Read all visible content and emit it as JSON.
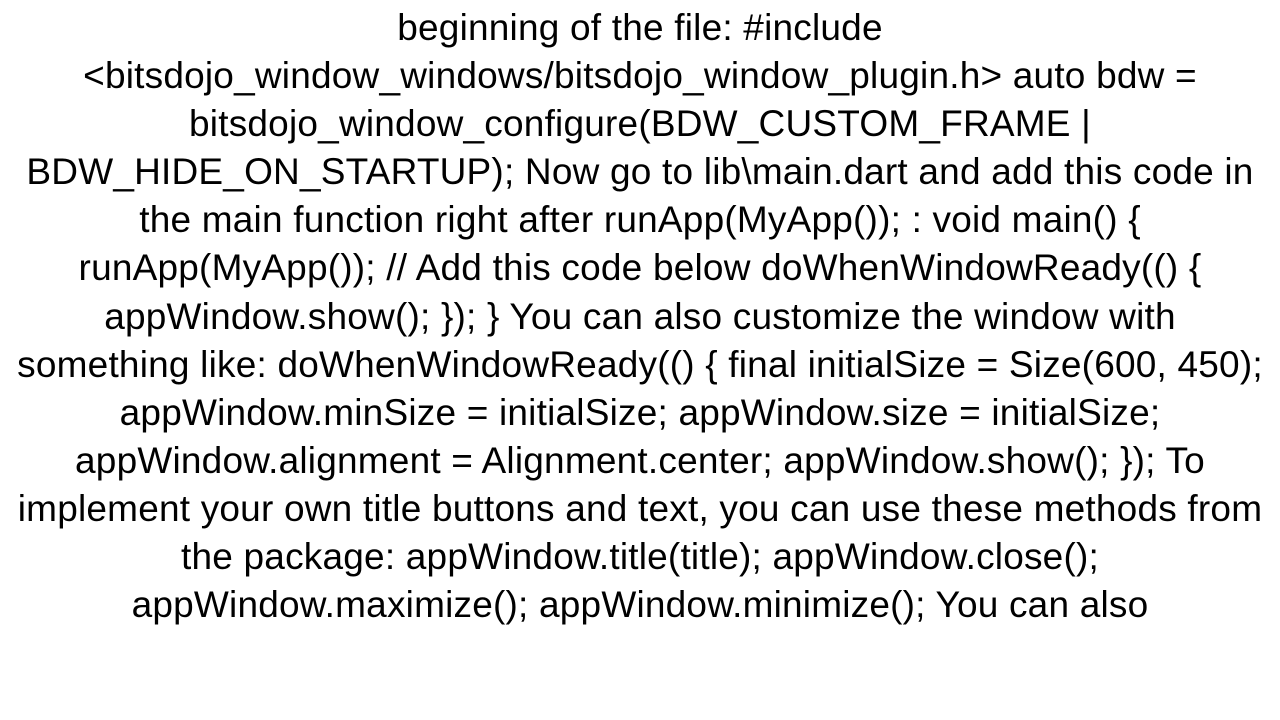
{
  "document": {
    "body": "beginning of the file: #include <bitsdojo_window_windows/bitsdojo_window_plugin.h> auto bdw = bitsdojo_window_configure(BDW_CUSTOM_FRAME | BDW_HIDE_ON_STARTUP);  Now go to lib\\main.dart and add this code in the main function right after runApp(MyApp()); :  void main() {   runApp(MyApp());    // Add this code below    doWhenWindowReady(() {     appWindow.show();   }); }  You can also customize the window with something like:  doWhenWindowReady(() {     final initialSize = Size(600, 450);     appWindow.minSize = initialSize;     appWindow.size = initialSize;     appWindow.alignment = Alignment.center;     appWindow.show();   });  To implement your own title buttons and text, you can use these methods from the package: appWindow.title(title); appWindow.close(); appWindow.maximize(); appWindow.minimize();  You can also"
  }
}
